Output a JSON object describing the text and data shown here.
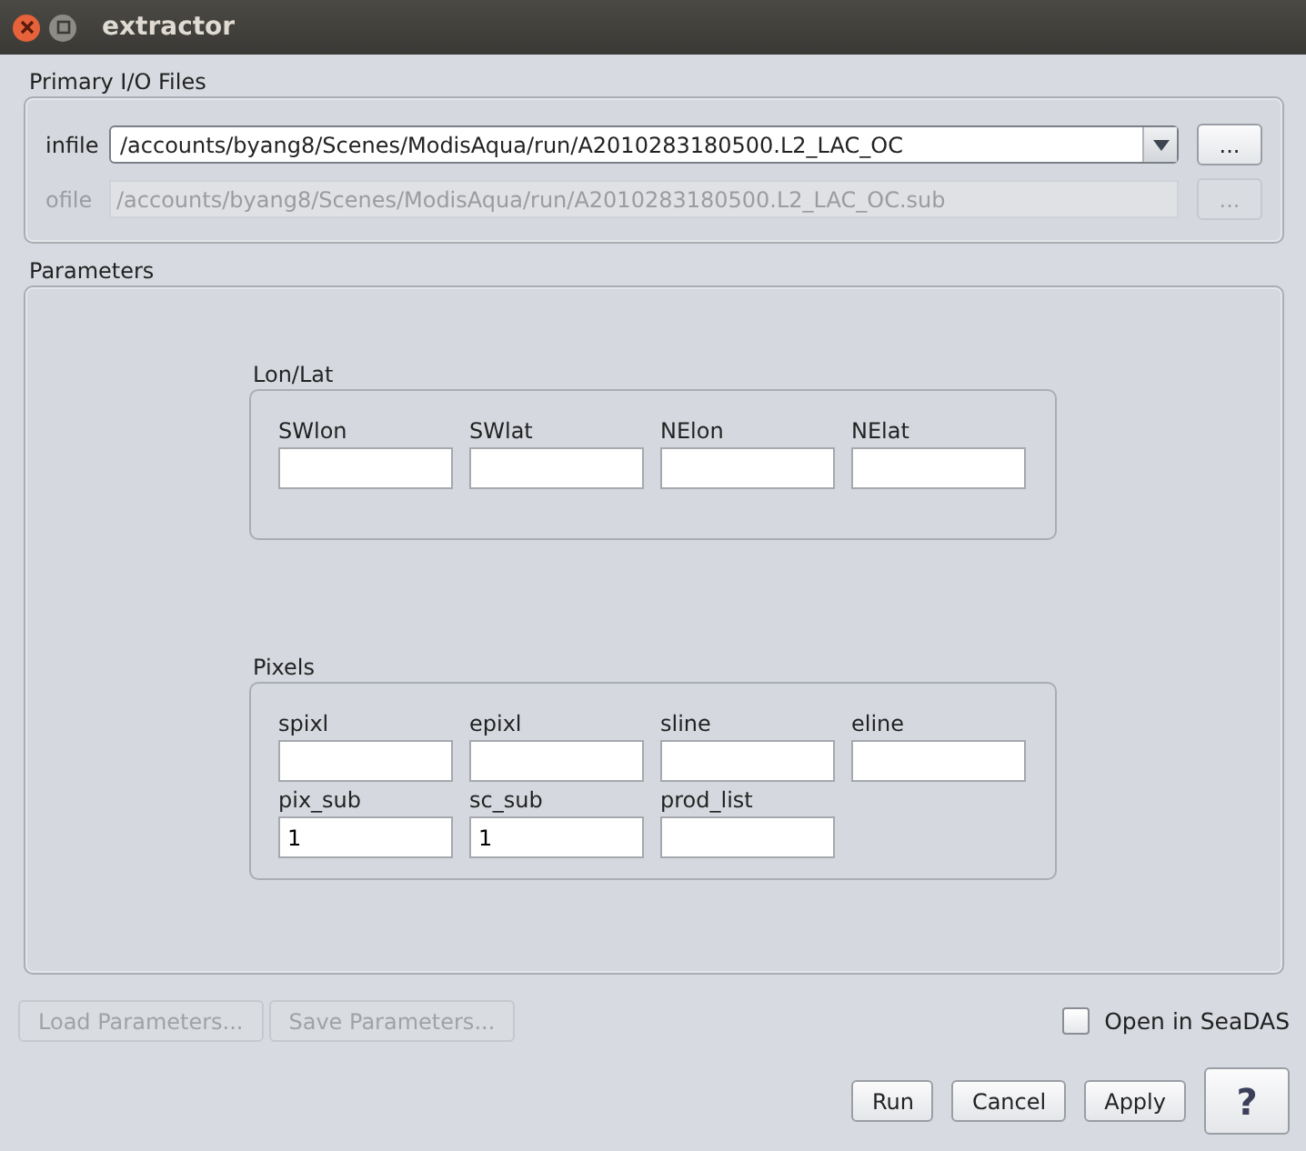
{
  "window": {
    "title": "extractor"
  },
  "io": {
    "title": "Primary I/O Files",
    "rows": [
      {
        "label": "infile",
        "value": "/accounts/byang8/Scenes/ModisAqua/run/A2010283180500.L2_LAC_OC",
        "disabled": false,
        "dropdown": true,
        "browse": "..."
      },
      {
        "label": "ofile",
        "value": "/accounts/byang8/Scenes/ModisAqua/run/A2010283180500.L2_LAC_OC.sub",
        "disabled": true,
        "dropdown": false,
        "browse": "..."
      }
    ]
  },
  "parameters": {
    "title": "Parameters",
    "groups": [
      {
        "title": "Lon/Lat",
        "fields": [
          {
            "label": "SWlon"
          },
          {
            "label": "SWlat"
          },
          {
            "label": "NElon"
          },
          {
            "label": "NElat"
          }
        ]
      },
      {
        "title": "Pixels",
        "fields": [
          {
            "label": "spixl"
          },
          {
            "label": "epixl"
          },
          {
            "label": "sline"
          },
          {
            "label": "eline"
          },
          {
            "label": "pix_sub",
            "value": "1"
          },
          {
            "label": "sc_sub",
            "value": "1"
          },
          {
            "label": "prod_list"
          }
        ]
      }
    ]
  },
  "param_buttons": [
    {
      "label": "Load Parameters...",
      "disabled": true
    },
    {
      "label": "Save Parameters...",
      "disabled": true
    }
  ],
  "open_in": {
    "label": "Open in SeaDAS",
    "checked": false
  },
  "buttons": [
    {
      "label": "Run"
    },
    {
      "label": "Cancel"
    },
    {
      "label": "Apply"
    }
  ],
  "help": "?"
}
